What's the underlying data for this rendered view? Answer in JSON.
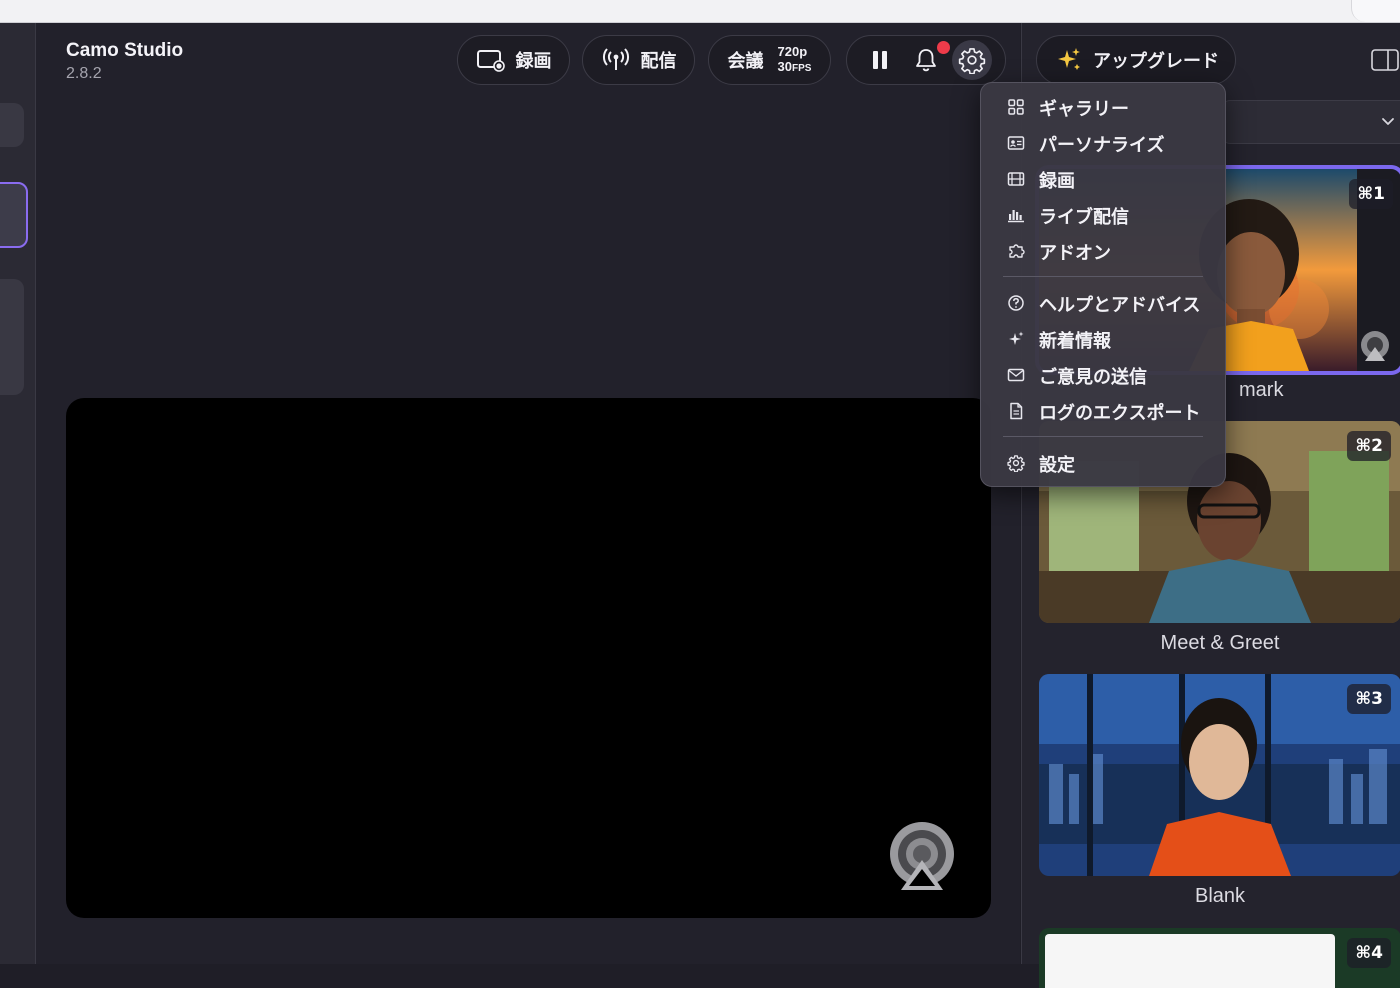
{
  "app": {
    "title": "Camo Studio",
    "version": "2.8.2"
  },
  "toolbar": {
    "record_label": "録画",
    "stream_label": "配信",
    "meeting_label": "会議",
    "resolution": "720p",
    "fps_value": "30",
    "fps_unit": "FPS"
  },
  "right_panel": {
    "upgrade_label": "アップグレード"
  },
  "backgrounds": [
    {
      "label": "mark",
      "shortcut": "⌘1",
      "selected": true
    },
    {
      "label": "Meet & Greet",
      "shortcut": "⌘2",
      "selected": false
    },
    {
      "label": "Blank",
      "shortcut": "⌘3",
      "selected": false
    },
    {
      "label": "",
      "shortcut": "⌘4",
      "selected": false
    }
  ],
  "menu": {
    "items": [
      {
        "label": "ギャラリー",
        "icon": "grid-icon"
      },
      {
        "label": "パーソナライズ",
        "icon": "id-card-icon"
      },
      {
        "label": "録画",
        "icon": "film-icon"
      },
      {
        "label": "ライブ配信",
        "icon": "bars-icon"
      },
      {
        "label": "アドオン",
        "icon": "puzzle-icon"
      },
      {
        "label": "ヘルプとアドバイス",
        "icon": "question-circle-icon"
      },
      {
        "label": "新着情報",
        "icon": "sparkle-icon"
      },
      {
        "label": "ご意見の送信",
        "icon": "envelope-icon"
      },
      {
        "label": "ログのエクスポート",
        "icon": "document-icon"
      },
      {
        "label": "設定",
        "icon": "gear-icon"
      }
    ]
  },
  "colors": {
    "accent": "#7b68ee",
    "notification": "#ee3b4a",
    "background": "#22212b"
  }
}
